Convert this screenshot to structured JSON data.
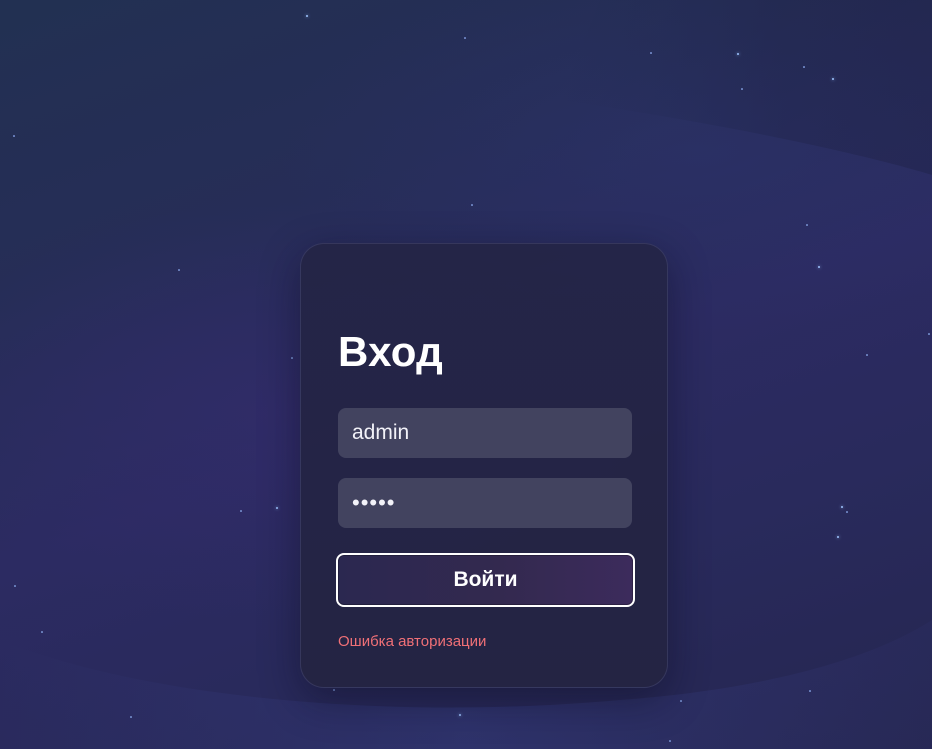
{
  "login": {
    "title": "Вход",
    "username_value": "admin",
    "password_value": "•••••",
    "submit_label": "Войти",
    "error_message": "Ошибка авторизации"
  },
  "colors": {
    "background": "#29295a",
    "card": "#242546",
    "input": "#42435f",
    "error": "#f07077",
    "button_border": "#ffffff"
  }
}
